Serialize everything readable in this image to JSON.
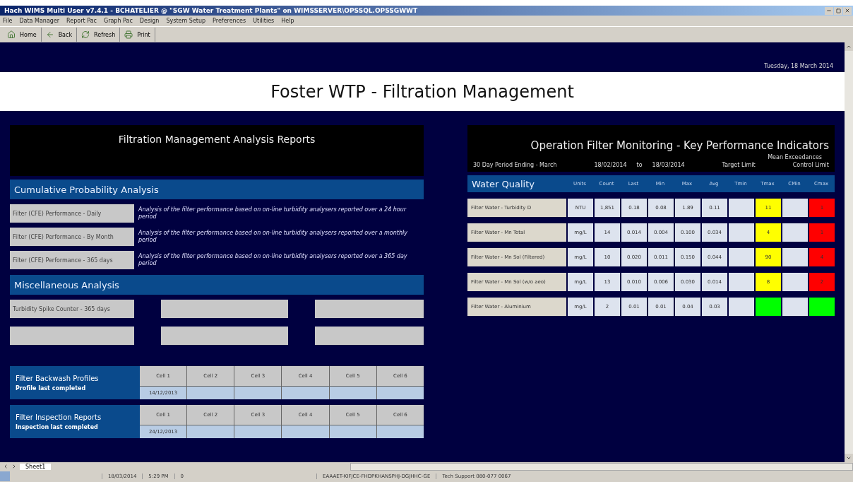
{
  "window": {
    "title": "Hach WIMS Multi User v7.4.1 - BCHATELIER @ \"SGW Water Treatment Plants\" on WIMSSERVER\\OPSSQL.OPSSGWWT"
  },
  "menu": [
    "File",
    "Data Manager",
    "Report Pac",
    "Graph Pac",
    "Design",
    "System Setup",
    "Preferences",
    "Utilities",
    "Help"
  ],
  "toolbar": [
    {
      "label": "Home",
      "kind": "home"
    },
    {
      "label": "Back",
      "kind": "back"
    },
    {
      "label": "Refresh",
      "kind": "refresh"
    },
    {
      "label": "Print",
      "kind": "print"
    }
  ],
  "date": "Tuesday, 18 March 2014",
  "page_title": "Foster WTP - Filtration Management",
  "reports": {
    "title": "Filtration Management Analysis Reports",
    "cumulative": {
      "heading": "Cumulative Probability Analysis",
      "items": [
        {
          "button": "Filter (CFE) Performance - Daily",
          "description": "Analysis of the filter performance based on on-line turbidity analysers reported over a 24 hour period"
        },
        {
          "button": "Filter (CFE) Performance - By Month",
          "description": "Analysis of the filter performance based on on-line turbidity analysers reported over a monthly period"
        },
        {
          "button": "Filter (CFE) Performance - 365 days",
          "description": "Analysis of the filter performance based on on-line turbidity analysers reported over a 365 day period"
        }
      ]
    },
    "misc": {
      "heading": "Miscellaneous Analysis",
      "buttons": [
        "Turbidity Spike Counter - 365 days"
      ]
    },
    "cell_tables": [
      {
        "title": "Filter Backwash Profiles",
        "subtitle": "Profile last completed",
        "cells": [
          "Cell 1",
          "Cell 2",
          "Cell 3",
          "Cell 4",
          "Cell 5",
          "Cell 6"
        ],
        "dates": [
          "14/12/2013"
        ]
      },
      {
        "title": "Filter Inspection Reports",
        "subtitle": "Inspection last completed",
        "cells": [
          "Cell 1",
          "Cell 2",
          "Cell 3",
          "Cell 4",
          "Cell 5",
          "Cell 6"
        ],
        "dates": [
          "24/12/2013"
        ]
      }
    ]
  },
  "kpi": {
    "title": "Operation Filter Monitoring - Key Performance Indicators",
    "exceedances_label": "Mean Exceedances",
    "period": "30 Day Period Ending - March",
    "from": "18/02/2014",
    "to_label": "to",
    "to": "18/03/2014",
    "target_label": "Target Limit",
    "control_label": "Control Limit",
    "heading": "Water Quality",
    "columns": [
      "Units",
      "Count",
      "Last",
      "Min",
      "Max",
      "Avg",
      "Tmin",
      "Tmax",
      "CMin",
      "Cmax"
    ],
    "rows": [
      {
        "name": "Filter Water - Turbidity D",
        "units": "NTU",
        "count": "1,851",
        "last": "0.18",
        "min": "0.08",
        "max": "1.89",
        "avg": "0.11",
        "tmax": {
          "value": "11",
          "color": "#ffff00"
        },
        "cmax": {
          "value": "1",
          "color": "#ff0000"
        }
      },
      {
        "name": "Filter Water - Mn Total",
        "units": "mg/L",
        "count": "14",
        "last": "0.014",
        "min": "0.004",
        "max": "0.100",
        "avg": "0.034",
        "tmax": {
          "value": "4",
          "color": "#ffff00"
        },
        "cmax": {
          "value": "1",
          "color": "#ff0000"
        }
      },
      {
        "name": "Filter Water - Mn Sol (Filtered)",
        "units": "mg/L",
        "count": "10",
        "last": "0.020",
        "min": "0.011",
        "max": "0.150",
        "avg": "0.044",
        "tmax": {
          "value": "90",
          "color": "#ffff00"
        },
        "cmax": {
          "value": "4",
          "color": "#ff0000"
        }
      },
      {
        "name": "Filter Water - Mn Sol (w/o aeo)",
        "units": "mg/L",
        "count": "13",
        "last": "0.010",
        "min": "0.006",
        "max": "0.030",
        "avg": "0.014",
        "tmax": {
          "value": "8",
          "color": "#ffff00"
        },
        "cmax": {
          "value": "2",
          "color": "#ff0000"
        }
      },
      {
        "name": "Filter Water - Aluminium",
        "units": "mg/L",
        "count": "2",
        "last": "0.01",
        "min": "0.01",
        "max": "0.04",
        "avg": "0.03",
        "tmax": {
          "color": "#00ff00"
        },
        "cmax": {
          "color": "#00ff00"
        }
      }
    ]
  },
  "sheet_tab": "Sheet1",
  "status_bar": [
    "18/03/2014",
    "5:29 PM",
    "0",
    "EAAAET-KIFJCE-FHDPKHANSPHJ-DGJHHC-GE",
    "Tech Support 080-077 0067"
  ]
}
